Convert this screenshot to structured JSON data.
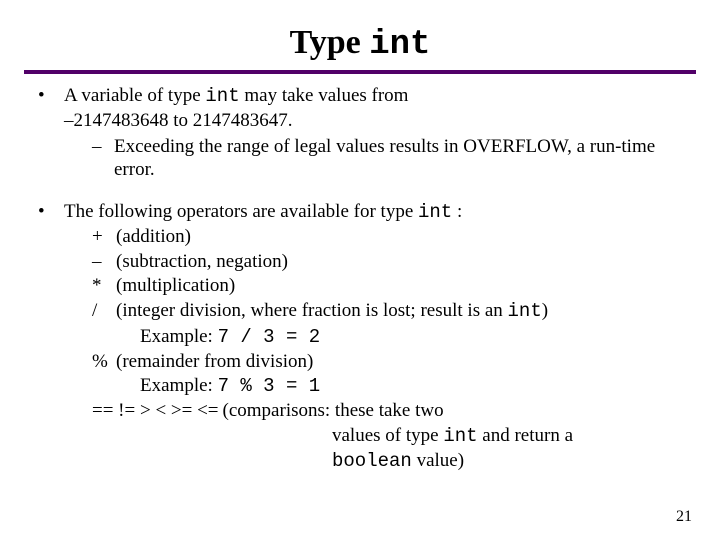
{
  "title": {
    "prefix": "Type ",
    "code": "int"
  },
  "bullet1": {
    "pre": "A variable of type ",
    "code": "int",
    "mid": " may take values from ",
    "range": "–2147483648 to 2147483647.",
    "sub1": "Exceeding the range of legal values results in OVERFLOW, a run-time error."
  },
  "bullet2": {
    "pre": "The following operators are available for type ",
    "code": "int",
    "post": " :",
    "ops": {
      "plus": {
        "sym": "+",
        "desc": "(addition)"
      },
      "minus": {
        "sym": "–",
        "desc": "(subtraction, negation)"
      },
      "star": {
        "sym": "*",
        "desc": "(multiplication)"
      },
      "slash": {
        "sym": "/",
        "desc_pre": "(integer division, where fraction is lost; result is an ",
        "desc_code": "int",
        "desc_post": ")",
        "ex_label": "Example: ",
        "ex_code": "7 / 3 = 2"
      },
      "pct": {
        "sym": "%",
        "desc": "(remainder from division)",
        "ex_label": "Example: ",
        "ex_code": "7 % 3 = 1"
      },
      "cmp": {
        "sym": "== != > < >= <=",
        "line1_pre": "  (comparisons:  these take two",
        "line2_pre": "values of type ",
        "line2_code": "int",
        "line2_mid": "  and return a",
        "line3_code": "boolean",
        "line3_post": " value)"
      }
    }
  },
  "page": "21"
}
